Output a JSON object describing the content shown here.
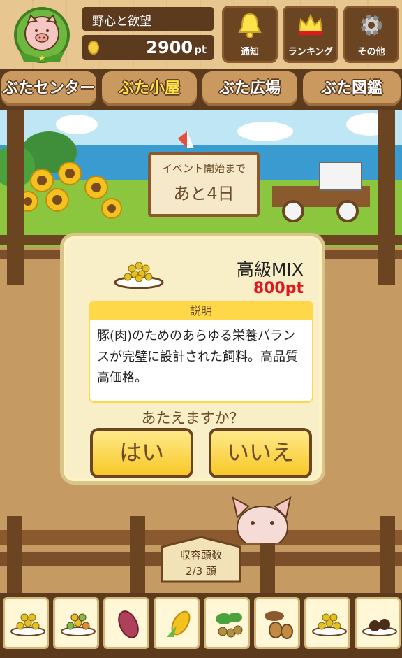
{
  "header": {
    "title": "野心と欲望",
    "points_value": "2900",
    "points_unit": "pt",
    "buttons": [
      {
        "label": "通知",
        "icon": "bell-icon"
      },
      {
        "label": "ランキング",
        "icon": "crown-icon"
      },
      {
        "label": "その他",
        "icon": "gear-icon"
      }
    ]
  },
  "tabs": [
    "ぶたセンター",
    "ぶた小屋",
    "ぶた広場",
    "ぶた図鑑"
  ],
  "active_tab": "ぶた小屋",
  "event_sign": {
    "line1": "イベント開始まで",
    "line2": "あと4日"
  },
  "dialog": {
    "item_name": "高級MIX",
    "price": "800pt",
    "description_header": "説明",
    "description": "豚(肉)のためのあらゆる栄養バランスが完璧に設計された飼料。高品質高価格。",
    "question": "あたえますか？",
    "yes": "はい",
    "no": "いいえ"
  },
  "capacity": {
    "label": "収容頭数",
    "value": "2/3 頭"
  },
  "food_slots": [
    "feed-pellets-icon",
    "mixed-feed-icon",
    "sweet-potato-icon",
    "corn-icon",
    "beans-icon",
    "acorn-icon",
    "premium-mix-icon",
    "truffle-icon"
  ],
  "colors": {
    "wood_dark": "#5b3a1e",
    "accent_yellow": "#ffd84a",
    "price_red": "#e0171b"
  }
}
